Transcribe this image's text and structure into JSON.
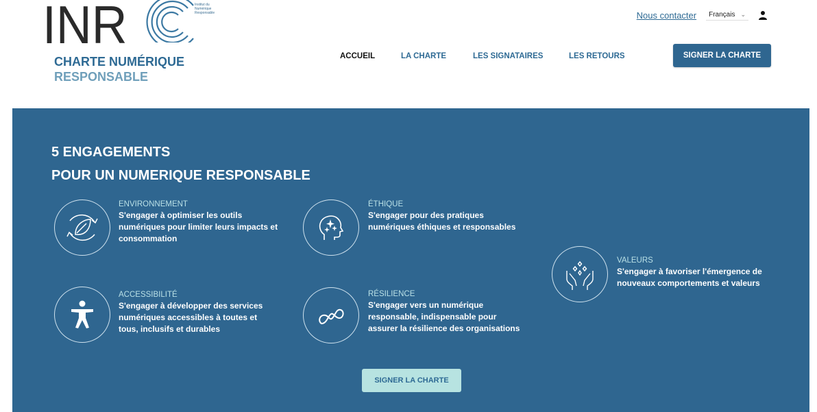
{
  "logo": {
    "letters": "INR",
    "institute_lines": [
      "Institut du",
      "Numérique",
      "Responsable"
    ]
  },
  "brand": {
    "title": "CHARTE NUMÉRIQUE",
    "subtitle": "RESPONSABLE"
  },
  "topbar": {
    "contact_label": "Nous contacter",
    "language": "Français"
  },
  "nav": {
    "items": [
      {
        "label": "ACCUEIL",
        "active": true
      },
      {
        "label": "LA CHARTE",
        "active": false
      },
      {
        "label": "LES SIGNATAIRES",
        "active": false
      },
      {
        "label": "LES RETOURS",
        "active": false
      }
    ],
    "cta_label": "SIGNER LA CHARTE"
  },
  "hero": {
    "title_line1": "5 ENGAGEMENTS",
    "title_line2": "POUR UN NUMERIQUE RESPONSABLE",
    "engagements": [
      {
        "title": "ENVIRONNEMENT",
        "icon": "leaf-cycle-icon",
        "description": "S'engager à optimiser les outils numériques pour limiter leurs impacts et consommation"
      },
      {
        "title": "ÉTHIQUE",
        "icon": "head-sparkle-icon",
        "description": "S'engager pour des pratiques numériques éthiques et responsables"
      },
      {
        "title": "VALEURS",
        "icon": "hands-sparkle-icon",
        "description": "S'engager à favoriser l'émergence de nouveaux comportements et valeurs"
      },
      {
        "title": "ACCESSIBILITÉ",
        "icon": "accessibility-person-icon",
        "description": "S'engager à développer des services numériques accessibles à toutes et tous, inclusifs et durables"
      },
      {
        "title": "RÉSILIENCE",
        "icon": "infinity-loop-icon",
        "description": "S'engager vers un numérique responsable, indispensable pour assurer la résilience des organisations"
      }
    ],
    "cta_label": "SIGNER LA CHARTE"
  },
  "colors": {
    "primary": "#2f6690",
    "accent_light": "#b7e3e1",
    "title_teal": "#b9e0e6",
    "brand_sub": "#6f9fba"
  }
}
